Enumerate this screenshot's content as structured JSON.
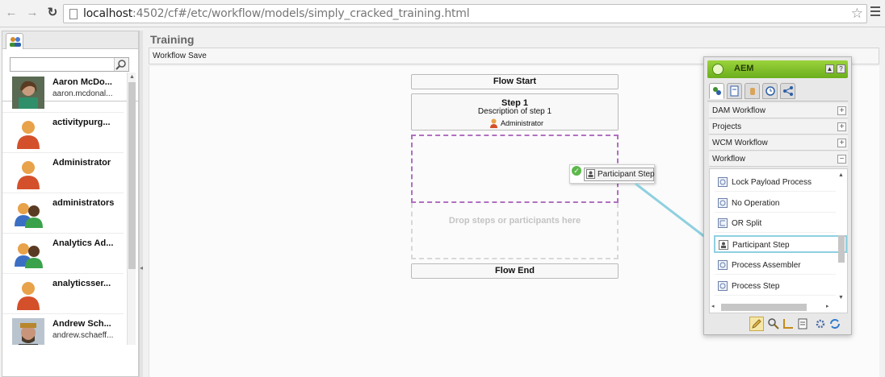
{
  "browser": {
    "url_host": "localhost",
    "url_rest": ":4502/cf#/etc/workflow/models/simply_cracked_training.html",
    "back_icon": "back-arrow-icon",
    "forward_icon": "forward-arrow-icon",
    "reload_icon": "reload-icon",
    "star_icon": "bookmark-star-icon",
    "menu_icon": "hamburger-menu-icon"
  },
  "left_panel": {
    "search_placeholder": "",
    "users": [
      {
        "name": "Aaron McDo...",
        "sub": "aaron.mcdonal...",
        "avatar": "photo"
      },
      {
        "name": "activitypurg...",
        "sub": "",
        "avatar": "user"
      },
      {
        "name": "Administrator",
        "sub": "",
        "avatar": "user"
      },
      {
        "name": "administrators",
        "sub": "",
        "avatar": "group"
      },
      {
        "name": "Analytics Ad...",
        "sub": "",
        "avatar": "group"
      },
      {
        "name": "analyticsser...",
        "sub": "",
        "avatar": "user"
      },
      {
        "name": "Andrew Sch...",
        "sub": "andrew.schaeff...",
        "avatar": "photo2"
      }
    ]
  },
  "page": {
    "title": "Training",
    "toolbar": {
      "workflow_label": "Workflow",
      "save_label": "Save"
    }
  },
  "workflow": {
    "flow_start": "Flow Start",
    "step1_title": "Step 1",
    "step1_desc": "Description of step 1",
    "step1_assignee": "Administrator",
    "drop_hint": "Drop steps or participants here",
    "flow_end": "Flow End",
    "drag_item": "Participant Step"
  },
  "sidekick": {
    "title": "AEM",
    "accent": "#7dbf2a",
    "groups": [
      {
        "label": "DAM Workflow",
        "toggle": "+"
      },
      {
        "label": "Projects",
        "toggle": "+"
      },
      {
        "label": "WCM Workflow",
        "toggle": "+"
      },
      {
        "label": "Workflow",
        "toggle": "−"
      }
    ],
    "items": [
      {
        "label": "Lock Payload Process"
      },
      {
        "label": "No Operation"
      },
      {
        "label": "OR Split"
      },
      {
        "label": "Participant Step"
      },
      {
        "label": "Process Assembler"
      },
      {
        "label": "Process Step"
      }
    ],
    "selected_item": "Participant Step"
  }
}
